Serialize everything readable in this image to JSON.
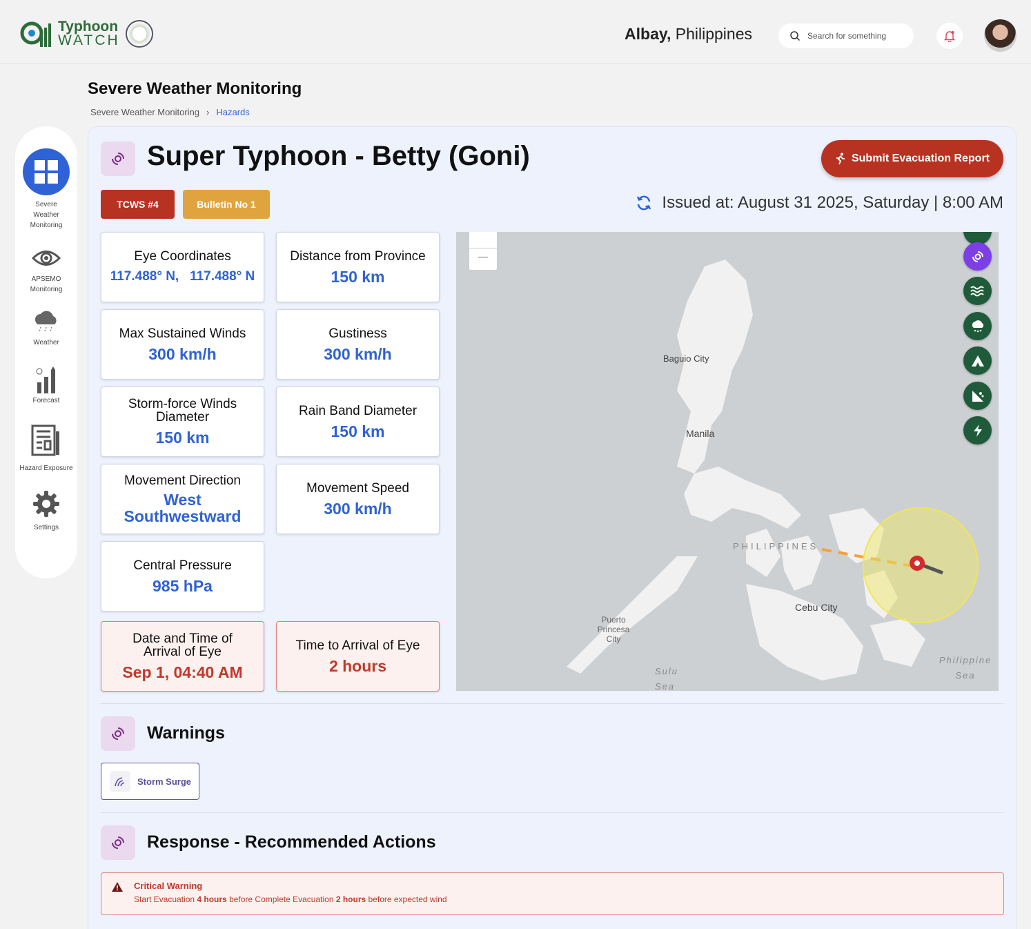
{
  "app": {
    "logo_line1": "Typhoon",
    "logo_line2": "WATCH",
    "province_bold": "Albay,",
    "province_rest": "Philippines",
    "search_placeholder": "Search for something"
  },
  "sidebar": {
    "items": [
      {
        "label": "Severe Weather Monitoring",
        "icon": "dashboard-grid-icon"
      },
      {
        "label": "APSEMO Monitoring",
        "icon": "eye-icon"
      },
      {
        "label": "Weather",
        "icon": "rain-cloud-icon"
      },
      {
        "label": "Forecast",
        "icon": "bar-chart-icon"
      },
      {
        "label": "Hazard Exposure",
        "icon": "newspaper-icon"
      },
      {
        "label": "Settings",
        "icon": "gear-icon"
      }
    ]
  },
  "page": {
    "title": "Severe Weather Monitoring",
    "breadcrumb": [
      "Severe Weather Monitoring",
      "Hazards"
    ]
  },
  "storm": {
    "title": "Super Typhoon - Betty (Goni)",
    "evac_button": "Submit Evacuation Report",
    "tcws": "TCWS #4",
    "bulletin": "Bulletin No 1",
    "issued": "Issued at: August 31 2025, Saturday | 8:00 AM",
    "cards": [
      {
        "label": "Eye Coordinates",
        "value": "117.488° N,   117.488° N"
      },
      {
        "label": "Distance from Province",
        "value": "150 km"
      },
      {
        "label": "Max Sustained Winds",
        "value": "300 km/h"
      },
      {
        "label": "Gustiness",
        "value": "300 km/h"
      },
      {
        "label": "Storm-force Winds Diameter",
        "value": "150 km"
      },
      {
        "label": "Rain Band Diameter",
        "value": "150 km"
      },
      {
        "label": "Movement Direction",
        "value": "West Southwestward"
      },
      {
        "label": "Movement Speed",
        "value": "300 km/h"
      },
      {
        "label": "Central Pressure",
        "value": "985 hPa"
      },
      {
        "label": "Date and Time of Arrival of Eye",
        "value": "Sep 1, 04:40 AM"
      },
      {
        "label": "Time to Arrival of Eye",
        "value": "2 hours"
      }
    ]
  },
  "map": {
    "labels": [
      "Baguio City",
      "Manila",
      "PHILIPPINES",
      "Cebu City",
      "Puerto Princesa City",
      "Sulu Sea",
      "Philippine Sea"
    ],
    "zoom_out": "—",
    "layer_buttons": [
      "typhoon-icon",
      "waves-icon",
      "rain-icon",
      "landslide-icon",
      "hazard-icon",
      "lightning-icon"
    ]
  },
  "warnings": {
    "title": "Warnings",
    "chip": "Storm Surge"
  },
  "response": {
    "title": "Response - Recommended Actions",
    "alert_title": "Critical Warning",
    "alert_p1": "Start Evacuation ",
    "alert_b1": "4 hours",
    "alert_p2": " before Complete Evacuation ",
    "alert_b2": "2 hours",
    "alert_p3": " before expected wind"
  },
  "colors": {
    "accent": "#2f62d4",
    "danger": "#b83222",
    "bulletin": "#e0a43f",
    "map_buttons": "#1f5b3a",
    "active_layer": "#7b3fe4"
  }
}
